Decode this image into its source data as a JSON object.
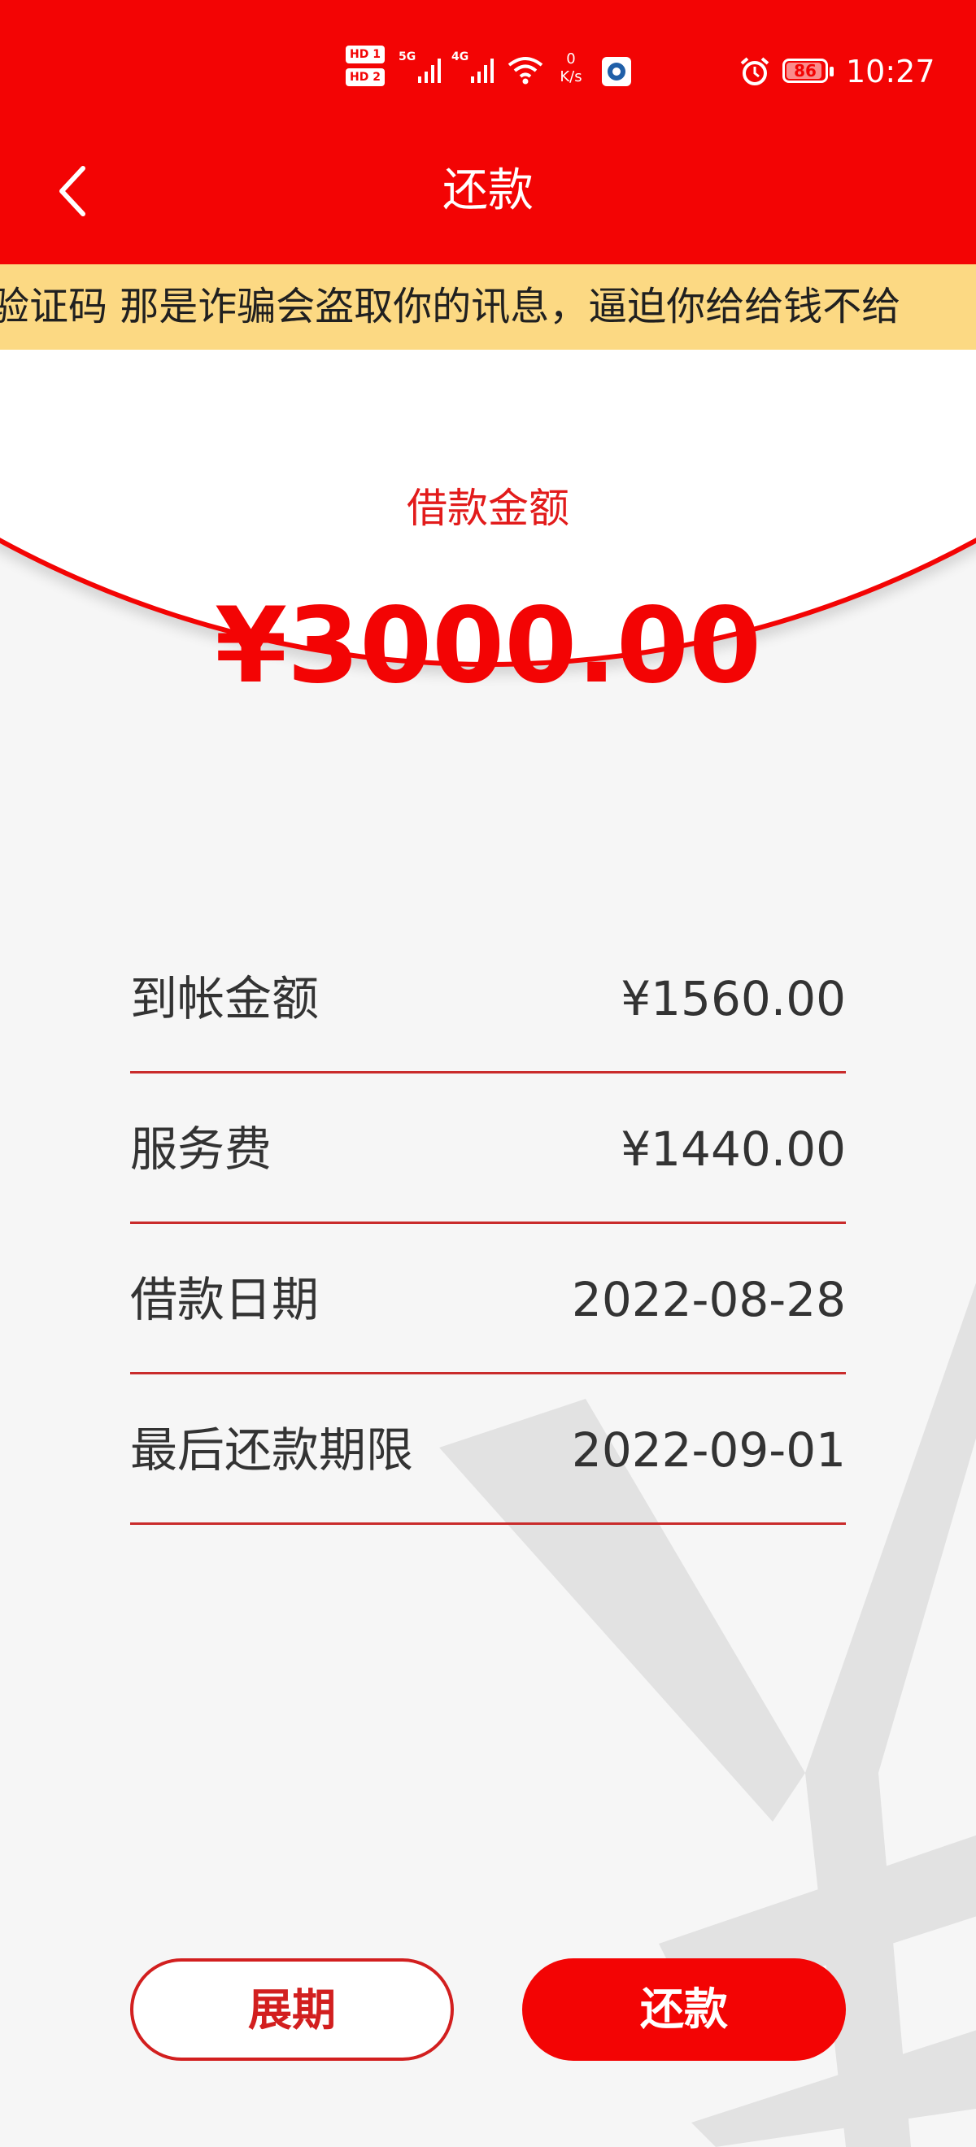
{
  "status_bar": {
    "hd1": "HD 1",
    "hd2": "HD 2",
    "sim1_gen": "5G",
    "sim2_gen": "4G",
    "net_rate_value": "0",
    "net_rate_unit": "K/s",
    "battery": "86",
    "time": "10:27"
  },
  "header": {
    "title": "还款"
  },
  "notice": {
    "text": "验证码 那是诈骗会盗取你的讯息，逼迫你给给钱不给"
  },
  "loan": {
    "label": "借款金额",
    "amount": "¥3000.00"
  },
  "details": [
    {
      "label": "到帐金额",
      "value": "¥1560.00"
    },
    {
      "label": "服务费",
      "value": "¥1440.00"
    },
    {
      "label": "借款日期",
      "value": "2022-08-28"
    },
    {
      "label": "最后还款期限",
      "value": "2022-09-01"
    }
  ],
  "actions": {
    "extend": "展期",
    "repay": "还款"
  },
  "colors": {
    "primary": "#f30404",
    "notice_bg": "#fcd983",
    "divider": "#c92b2b",
    "page_bg": "#f6f6f6"
  },
  "icons": {
    "back": "chevron-left-icon",
    "watermark": "yen-watermark-icon"
  }
}
